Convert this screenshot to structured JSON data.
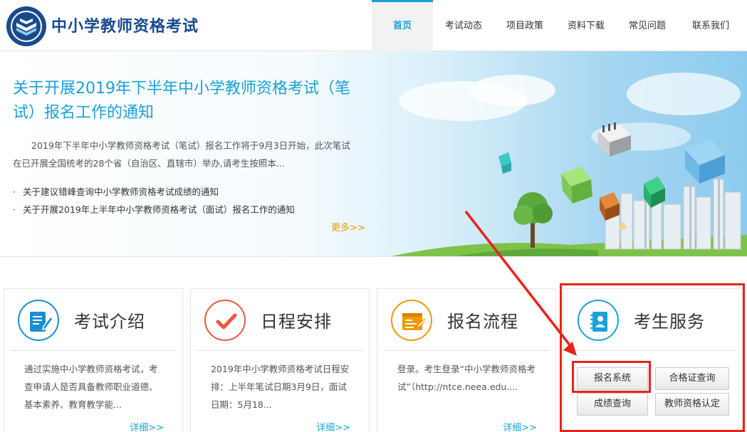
{
  "site": {
    "title": "中小学教师资格考试"
  },
  "nav": {
    "items": [
      {
        "label": "首页",
        "active": true
      },
      {
        "label": "考试动态",
        "active": false
      },
      {
        "label": "项目政策",
        "active": false
      },
      {
        "label": "资料下载",
        "active": false
      },
      {
        "label": "常见问题",
        "active": false
      },
      {
        "label": "联系我们",
        "active": false
      }
    ]
  },
  "banner": {
    "headline": "关于开展2019年下半年中小学教师资格考试（笔试）报名工作的通知",
    "summary": "2019年下半年中小学教师资格考试（笔试）报名工作将于9月3日开始，此次笔试在已开展全国统考的28个省（自治区、直辖市）举办,请考生按照本...",
    "news": [
      "关于建议错峰查询中小学教师资格考试成绩的通知",
      "关于开展2019年上半年中小学教师资格考试（面试）报名工作的通知"
    ],
    "bullet": "·",
    "more": "更多>>"
  },
  "cards": [
    {
      "title": "考试介绍",
      "icon": "document-edit-icon",
      "color": "#1a8fd1",
      "body": "通过实施中小学教师资格考试，考查申请人是否具备教师职业道德、基本素养、教育教学能...",
      "more": "详细>>"
    },
    {
      "title": "日程安排",
      "icon": "checkmark-icon",
      "color": "#e85a3c",
      "body": "2019年中小学教师资格考试日程安排：上半年笔试日期3月9日，面试日期：5月18...",
      "more": "详细>>"
    },
    {
      "title": "报名流程",
      "icon": "form-icon",
      "color": "#f39800",
      "body": "登录。考生登录“中小学教师资格考试”（http://ntce.neea.edu....",
      "more": "详细>>"
    }
  ],
  "service": {
    "title": "考生服务",
    "icon": "contact-book-icon",
    "color": "#1aa1d8",
    "buttons": [
      "报名系统",
      "合格证查询",
      "成绩查询",
      "教师资格认定"
    ]
  },
  "annotation": {
    "color": "#e8231c"
  }
}
